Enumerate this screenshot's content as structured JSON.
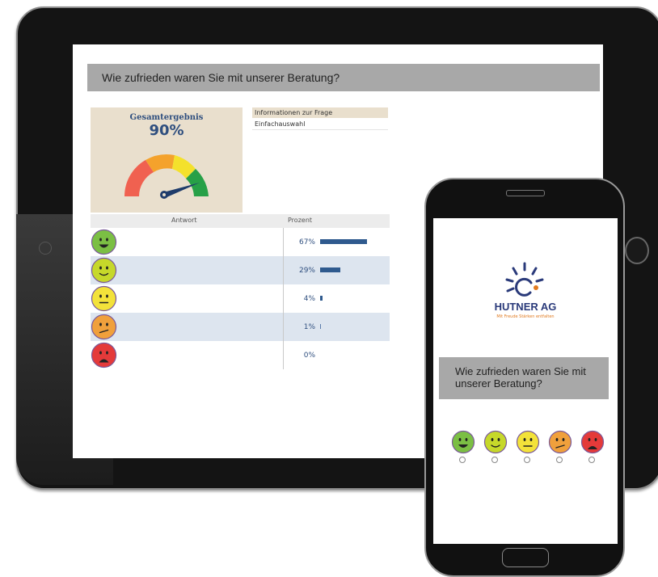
{
  "question": "Wie zufrieden waren Sie mit unserer Beratung?",
  "result": {
    "label": "Gesamtergebnis",
    "value": "90%",
    "score_fraction": 0.9
  },
  "info": {
    "header": "Informationen zur Frage",
    "value": "Einfachauswahl"
  },
  "table": {
    "col_answer": "Antwort",
    "col_percent": "Prozent",
    "rows": [
      {
        "face": "very-happy",
        "color": "#7bbf44",
        "percent_label": "67%",
        "percent": 67
      },
      {
        "face": "happy",
        "color": "#c6d82a",
        "percent_label": "29%",
        "percent": 29
      },
      {
        "face": "neutral",
        "color": "#f3e23a",
        "percent_label": "4%",
        "percent": 4
      },
      {
        "face": "unhappy",
        "color": "#f0a03c",
        "percent_label": "1%",
        "percent": 1
      },
      {
        "face": "very-unhappy",
        "color": "#e43a3a",
        "percent_label": "0%",
        "percent": 0
      }
    ]
  },
  "phone": {
    "logo_name": "HUTNER AG",
    "logo_tagline": "Mit Freude Stärken entfalten",
    "question": "Wie zufrieden waren Sie mit unserer Beratung?",
    "options": [
      {
        "face": "very-happy",
        "color": "#7bbf44"
      },
      {
        "face": "happy",
        "color": "#c6d82a"
      },
      {
        "face": "neutral",
        "color": "#f3e23a"
      },
      {
        "face": "unhappy",
        "color": "#f0a03c"
      },
      {
        "face": "very-unhappy",
        "color": "#e43a3a"
      }
    ]
  },
  "colors": {
    "bar": "#2f5a8e",
    "accent_text": "#2f4f7f",
    "gauge_needle": "#1f3c6b"
  }
}
